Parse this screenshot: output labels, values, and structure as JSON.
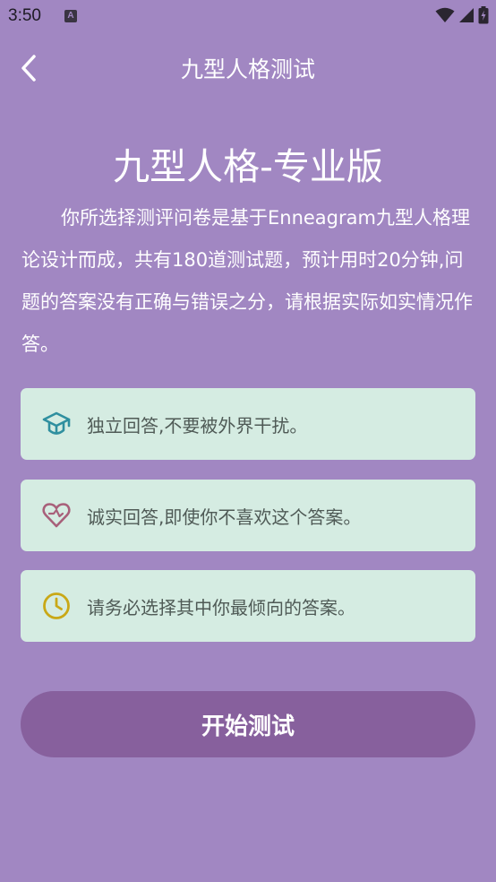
{
  "status_bar": {
    "time": "3:50",
    "notification_glyph": "A"
  },
  "header": {
    "title": "九型人格测试"
  },
  "main": {
    "title": "九型人格-专业版",
    "intro": "你所选择测评问卷是基于Enneagram九型人格理论设计而成，共有180道测试题，预计用时20分钟,问题的答案没有正确与错误之分，请根据实际如实情况作答。",
    "tips": [
      {
        "icon": "graduation-cap-icon",
        "text": "独立回答,不要被外界干扰。",
        "icon_color": "#2f8f9f"
      },
      {
        "icon": "heart-icon",
        "text": "诚实回答,即使你不喜欢这个答案。",
        "icon_color": "#a8607a"
      },
      {
        "icon": "clock-icon",
        "text": "请务必选择其中你最倾向的答案。",
        "icon_color": "#c9a817"
      }
    ],
    "start_label": "开始测试"
  },
  "colors": {
    "background": "#a187c2",
    "card_background": "#d5ece2",
    "button_background": "#87609d"
  }
}
